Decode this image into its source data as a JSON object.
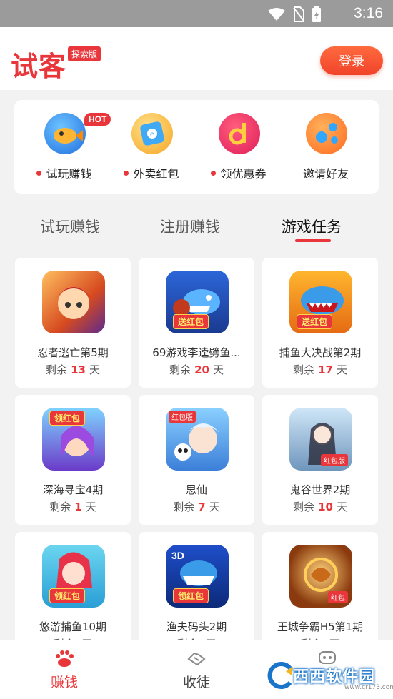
{
  "status_bar": {
    "time": "3:16"
  },
  "header": {
    "logo_text": "试客",
    "logo_badge": "探索版",
    "login_label": "登录"
  },
  "quick_entries": [
    {
      "label": "试玩赚钱",
      "icon": "fish-icon",
      "has_dot": true,
      "hot": "HOT"
    },
    {
      "label": "外卖红包",
      "icon": "envelope-icon",
      "has_dot": true
    },
    {
      "label": "领优惠券",
      "icon": "coupon-icon",
      "has_dot": true
    },
    {
      "label": "邀请好友",
      "icon": "share-icon",
      "has_dot": false
    }
  ],
  "tabs": [
    {
      "label": "试玩赚钱",
      "active": false
    },
    {
      "label": "注册赚钱",
      "active": false
    },
    {
      "label": "游戏任务",
      "active": true
    }
  ],
  "remaining_prefix": "剩余",
  "remaining_suffix": "天",
  "games": [
    {
      "name": "忍者逃亡第5期",
      "days": "13",
      "badge": ""
    },
    {
      "name": "69游戏李逵劈鱼...",
      "days": "20",
      "badge": "送红包"
    },
    {
      "name": "捕鱼大决战第2期",
      "days": "17",
      "badge": "送红包"
    },
    {
      "name": "深海寻宝4期",
      "days": "1",
      "badge": "领红包"
    },
    {
      "name": "思仙",
      "days": "7",
      "badge": "红包版"
    },
    {
      "name": "鬼谷世界2期",
      "days": "10",
      "badge": "红包版"
    },
    {
      "name": "悠游捕鱼10期",
      "days": "",
      "badge": "领红包"
    },
    {
      "name": "渔夫码头2期",
      "days": "",
      "badge": "领红包"
    },
    {
      "name": "王城争霸H5第1期",
      "days": "",
      "badge": "红包"
    }
  ],
  "bottom_nav": [
    {
      "label": "赚钱",
      "icon": "paw-icon",
      "active": true
    },
    {
      "label": "收徒",
      "icon": "handshake-icon",
      "active": false
    },
    {
      "label": "",
      "icon": "chat-bot-icon",
      "active": false
    }
  ],
  "watermark": {
    "text": "西西软件园",
    "url": "www.cr173.com"
  },
  "colors": {
    "accent": "#e8363b",
    "background": "#f2f2f2"
  }
}
